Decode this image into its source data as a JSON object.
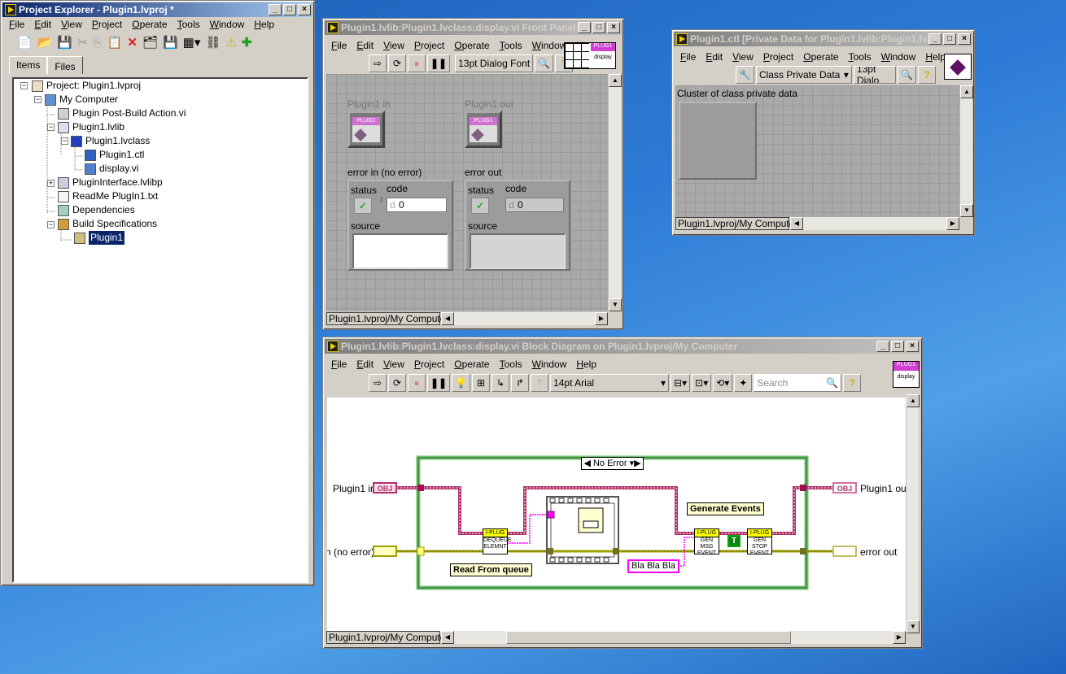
{
  "project_explorer": {
    "title": "Project Explorer - Plugin1.lvproj *",
    "menu": [
      "File",
      "Edit",
      "View",
      "Project",
      "Operate",
      "Tools",
      "Window",
      "Help"
    ],
    "tabs": [
      "Items",
      "Files"
    ],
    "tree": [
      {
        "label": "Project: Plugin1.lvproj",
        "icon": "project-icon"
      },
      {
        "label": "My Computer",
        "icon": "computer-icon"
      },
      {
        "label": "Plugin Post-Build Action.vi",
        "icon": "vi-icon"
      },
      {
        "label": "Plugin1.lvlib",
        "icon": "library-icon"
      },
      {
        "label": "Plugin1.lvclass",
        "icon": "class-cube-icon"
      },
      {
        "label": "Plugin1.ctl",
        "icon": "class-private-data-icon"
      },
      {
        "label": "display.vi",
        "icon": "vi-icon"
      },
      {
        "label": "PluginInterface.lvlibp",
        "icon": "packed-library-icon"
      },
      {
        "label": "ReadMe PlugIn1.txt",
        "icon": "text-file-icon"
      },
      {
        "label": "Dependencies",
        "icon": "dependencies-icon"
      },
      {
        "label": "Build Specifications",
        "icon": "build-specs-icon"
      },
      {
        "label": "Plugin1",
        "icon": "build-spec-icon",
        "selected": true
      }
    ]
  },
  "front_panel": {
    "title": "Plugin1.lvlib:Plugin1.lvclass:display.vi Front Panel ...",
    "menu": [
      "File",
      "Edit",
      "View",
      "Project",
      "Operate",
      "Tools",
      "Window",
      "He"
    ],
    "font": "13pt Dialog Font",
    "icon": {
      "header": "PLUG1",
      "body": "display"
    },
    "plugin_in": "Plugin1 in",
    "plugin_out": "Plugin1 out",
    "class_badge": "PLUG1",
    "error_in": {
      "label": "error in (no error)",
      "status": "status",
      "code": "code",
      "code_value": "0",
      "radix": "d",
      "source": "source"
    },
    "error_out": {
      "label": "error out",
      "status": "status",
      "code": "code",
      "code_value": "0",
      "radix": "d",
      "source": "source"
    },
    "status_bar": "Plugin1.lvproj/My Computer"
  },
  "private_data": {
    "title": "Plugin1.ctl [Private Data for Plugin1.lvlib:Plugin1.lv...",
    "menu": [
      "File",
      "Edit",
      "View",
      "Project",
      "Operate",
      "Tools",
      "Window",
      "Help"
    ],
    "mode": "Class Private Data",
    "font": "13pt Dialo",
    "cluster_label": "Cluster of class private data",
    "status_bar": "Plugin1.lvproj/My Computer"
  },
  "block_diagram": {
    "title": "Plugin1.lvlib:Plugin1.lvclass:display.vi Block Diagram on Plugin1.lvproj/My Computer",
    "menu": [
      "File",
      "Edit",
      "View",
      "Project",
      "Operate",
      "Tools",
      "Window",
      "Help"
    ],
    "font": "14pt Arial",
    "search_placeholder": "Search",
    "icon": {
      "header": "PLUG1",
      "body": "display"
    },
    "case_selector": "No Error",
    "plugin_in": "Plugin1 in",
    "plugin_out": "Plugin1 out",
    "error_in": "n (no error)",
    "error_out": "error out",
    "obj": "OBJ",
    "nodes": [
      {
        "header": "I-PLUG",
        "body": "DEQUEUE ELEMNT"
      },
      {
        "header": "I-PLUG",
        "body": "GEN MSG EVENT"
      },
      {
        "header": "I-PLUG",
        "body": "GEN STOP EVENT"
      }
    ],
    "true_const": "T",
    "string_const": "Bla Bla Bla",
    "comments": [
      "Generate Events",
      "Read From queue"
    ],
    "status_bar": "Plugin1.lvproj/My Computer",
    "colors": {
      "class_wire": "#b0306a",
      "error_wire": "#a0a000",
      "string_wire": "#ff00ff",
      "case_border": "#70c070"
    }
  }
}
